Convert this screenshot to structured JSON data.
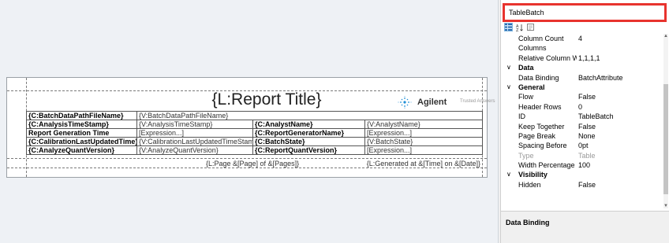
{
  "report": {
    "title": "{L:Report Title}",
    "logo_text": "Agilent",
    "logo_tagline": "Trusted Answers",
    "rows": [
      [
        "{C:BatchDataPathFileName}",
        "{V:BatchDataPathFileName}",
        "",
        ""
      ],
      [
        "{C:AnalysisTimeStamp}",
        "{V:AnalysisTimeStamp}",
        "{C:AnalystName}",
        "{V:AnalystName}"
      ],
      [
        "Report Generation Time",
        "[Expression...]",
        "{C:ReportGeneratorName}",
        "[Expression...]"
      ],
      [
        "{C:CalibrationLastUpdatedTime}",
        "{V:CalibrationLastUpdatedTimeStamp}",
        "{C:BatchState}",
        "{V:BatchState}"
      ],
      [
        "{C:AnalyzeQuantVersion}",
        "{V:AnalyzeQuantVersion}",
        "{C:ReportQuantVersion}",
        "[Expression...]"
      ]
    ],
    "page_number": "{L:Page &[Page] of &[Pages]}",
    "generated": "{L:Generated at &[Time] on &[Date]}"
  },
  "properties": {
    "object_name": "TableBatch",
    "top_rows": [
      {
        "name": "Column Count",
        "value": "4"
      },
      {
        "name": "Columns",
        "value": ""
      },
      {
        "name": "Relative Column Widths",
        "value": "1,1,1,1"
      }
    ],
    "data_category": "Data",
    "data_rows": [
      {
        "name": "Data Binding",
        "value": "BatchAttribute"
      }
    ],
    "general_category": "General",
    "general_rows": [
      {
        "name": "Flow",
        "value": "False"
      },
      {
        "name": "Header Rows",
        "value": "0"
      },
      {
        "name": "ID",
        "value": "TableBatch"
      },
      {
        "name": "Keep Together",
        "value": "False"
      },
      {
        "name": "Page Break",
        "value": "None"
      },
      {
        "name": "Spacing Before",
        "value": "0pt"
      },
      {
        "name": "Type",
        "value": "Table"
      },
      {
        "name": "Width Percentage",
        "value": "100"
      }
    ],
    "visibility_category": "Visibility",
    "visibility_rows": [
      {
        "name": "Hidden",
        "value": "False"
      }
    ],
    "description_title": "Data Binding"
  },
  "colors": {
    "selection_border": "#e8332e",
    "logo_accent": "#1f8fd6"
  }
}
